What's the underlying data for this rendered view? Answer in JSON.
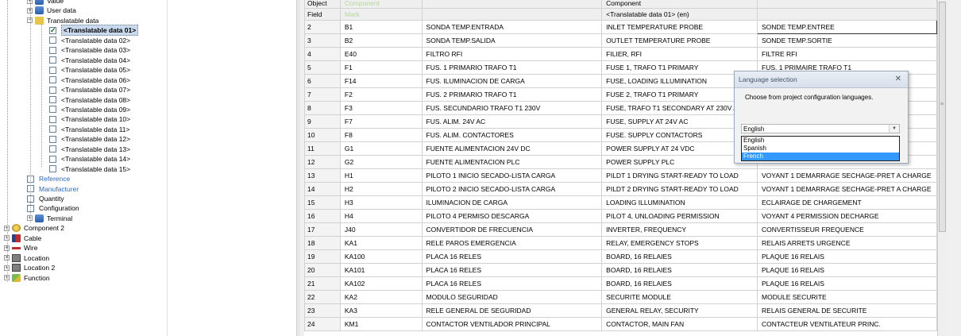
{
  "tree": {
    "items": [
      {
        "label": "Value",
        "icon": "database-icon"
      },
      {
        "label": "User data",
        "icon": "database-icon"
      },
      {
        "label": "Translatable data",
        "icon": "folder-icon"
      },
      {
        "label": "<Translatable data 01>",
        "checked": true,
        "selected": true
      },
      {
        "label": "<Translatable data 02>"
      },
      {
        "label": "<Translatable data 03>"
      },
      {
        "label": "<Translatable data 04>"
      },
      {
        "label": "<Translatable data 05>"
      },
      {
        "label": "<Translatable data 06>"
      },
      {
        "label": "<Translatable data 07>"
      },
      {
        "label": "<Translatable data 08>"
      },
      {
        "label": "<Translatable data 09>"
      },
      {
        "label": "<Translatable data 10>"
      },
      {
        "label": "<Translatable data 11>"
      },
      {
        "label": "<Translatable data 12>"
      },
      {
        "label": "<Translatable data 13>"
      },
      {
        "label": "<Translatable data 14>"
      },
      {
        "label": "<Translatable data 15>"
      },
      {
        "label": "Reference"
      },
      {
        "label": "Manufacturer"
      },
      {
        "label": "Quantity"
      },
      {
        "label": "Configuration"
      },
      {
        "label": "Terminal",
        "icon": "database-icon"
      },
      {
        "label": "Component 2",
        "icon": "component-icon"
      },
      {
        "label": "Cable",
        "icon": "cable-icon"
      },
      {
        "label": "Wire",
        "icon": "wire-icon"
      },
      {
        "label": "Location",
        "icon": "location-icon"
      },
      {
        "label": "Location 2",
        "icon": "location-icon"
      },
      {
        "label": "Function",
        "icon": "function-icon"
      }
    ]
  },
  "grid": {
    "header_object": {
      "rowhead": "Object",
      "c1": "Component",
      "c2": "",
      "c3": "Component",
      "c4": ""
    },
    "header_field": {
      "rowhead": "Field",
      "c1": "Mark",
      "c2": "",
      "c3": "<Translatable data 01> (en)",
      "c4": ""
    },
    "rows": [
      {
        "n": "2",
        "mark": "B1",
        "es": "SONDA TEMP.ENTRADA",
        "en": "INLET TEMPERATURE PROBE",
        "fr": "SONDE TEMP.ENTREE"
      },
      {
        "n": "3",
        "mark": "B2",
        "es": "SONDA TEMP.SALIDA",
        "en": "OUTLET TEMPERATURE PROBE",
        "fr": "SONDE TEMP.SORTIE"
      },
      {
        "n": "4",
        "mark": "E40",
        "es": "FILTRO RFI",
        "en": "FILIER, RFI",
        "fr": "FILTRE RFI"
      },
      {
        "n": "5",
        "mark": "F1",
        "es": "FUS. 1 PRIMARIO TRAFO T1",
        "en": "FUSE 1, TRAFO T1 PRIMARY",
        "fr": "FUS. 1 PRIMAIRE TRAFO T1"
      },
      {
        "n": "6",
        "mark": "F14",
        "es": "FUS. ILUMINACION DE CARGA",
        "en": "FUSE, LOADING ILLUMINATION",
        "fr": ""
      },
      {
        "n": "7",
        "mark": "F2",
        "es": "FUS. 2 PRIMARIO TRAFO T1",
        "en": "FUSE 2, TRAFO T1 PRIMARY",
        "fr": ""
      },
      {
        "n": "8",
        "mark": "F3",
        "es": "FUS. SECUNDARIO TRAFO T1 230V",
        "en": "FUSE, TRAFO T1 SECONDARY AT 230V A",
        "fr": ""
      },
      {
        "n": "9",
        "mark": "F7",
        "es": "FUS. ALIM. 24V AC",
        "en": "FUSE, SUPPLY AT 24V AC",
        "fr": ""
      },
      {
        "n": "10",
        "mark": "F8",
        "es": "FUS. ALIM. CONTACTORES",
        "en": "FUSE. SUPPLY CONTACTORS",
        "fr": ""
      },
      {
        "n": "11",
        "mark": "G1",
        "es": "FUENTE ALIMENTACION 24V DC",
        "en": "POWER SUPPLY AT 24 VDC",
        "fr": ""
      },
      {
        "n": "12",
        "mark": "G2",
        "es": "FUENTE ALIMENTACION PLC",
        "en": "POWER SUPPLY PLC",
        "fr": ""
      },
      {
        "n": "13",
        "mark": "H1",
        "es": "PILOTO 1 INICIO SECADO-LISTA CARGA",
        "en": "PILDT 1 DRYING START-READY TO LOAD",
        "fr": "VOYANT 1 DEMARRAGE SECHAGE-PRET A CHARGE"
      },
      {
        "n": "14",
        "mark": "H2",
        "es": "PILOTO 2 INICIO SECADO-LISTA CARGA",
        "en": "PILDT 2 DRYING START-READY TO LOAD",
        "fr": "VOYANT 1 DEMARRAGE SECHAGE-PRET A CHARGE"
      },
      {
        "n": "15",
        "mark": "H3",
        "es": "ILUMINACION DE CARGA",
        "en": "LOADING ILLUMINATION",
        "fr": "ECLAIRAGE DE CHARGEMENT"
      },
      {
        "n": "16",
        "mark": "H4",
        "es": "PILOTO 4 PERMISO DESCARGA",
        "en": "PILOT 4, UNLOADING PERMISSION",
        "fr": "VOYANT 4 PERMISSION DECHARGE"
      },
      {
        "n": "17",
        "mark": "J40",
        "es": "CONVERTIDOR DE FRECUENCIA",
        "en": "INVERTER, FREQUENCY",
        "fr": "CONVERTISSEUR FREQUENCE"
      },
      {
        "n": "18",
        "mark": "KA1",
        "es": "RELE PAROS EMERGENCIA",
        "en": "RELAY, EMERGENCY STOPS",
        "fr": "RELAIS ARRETS URGENCE"
      },
      {
        "n": "19",
        "mark": "KA100",
        "es": "PLACA 16 RELES",
        "en": "BOARD, 16 RELAIES",
        "fr": "PLAQUE 16 RELAIS"
      },
      {
        "n": "20",
        "mark": "KA101",
        "es": "PLACA 16 RELES",
        "en": "BOARD, 16 RELAIES",
        "fr": "PLAQUE 16 RELAIS"
      },
      {
        "n": "21",
        "mark": "KA102",
        "es": "PLACA 16 RELES",
        "en": "BOARD, 16 RELAIES",
        "fr": "PLAQUE 16 RELAIS"
      },
      {
        "n": "22",
        "mark": "KA2",
        "es": "MODULO SEGURIDAD",
        "en": "SECURITE MODULE",
        "fr": "MODULE SECURITE"
      },
      {
        "n": "23",
        "mark": "KA3",
        "es": "RELE GENERAL DE SEGURIDAD",
        "en": "GENERAL RELAY, SECURITY",
        "fr": "RELAIS GENERAL DE SECURITE"
      },
      {
        "n": "24",
        "mark": "KM1",
        "es": "CONTACTOR VENTILADOR PRINCIPAL",
        "en": "CONTACTOR, MAIN FAN",
        "fr": "CONTACTEUR VENTILATEUR PRINC."
      }
    ]
  },
  "dialog": {
    "title": "Language selection",
    "message": "Choose from project configuration languages.",
    "selected": "English",
    "options": [
      "English",
      "Spanish",
      "French"
    ],
    "highlighted_index": 2
  },
  "colors": {
    "header_green": "#2e8b2e",
    "header_yellow": "#fff7c2",
    "selection_blue": "#3399ff"
  }
}
